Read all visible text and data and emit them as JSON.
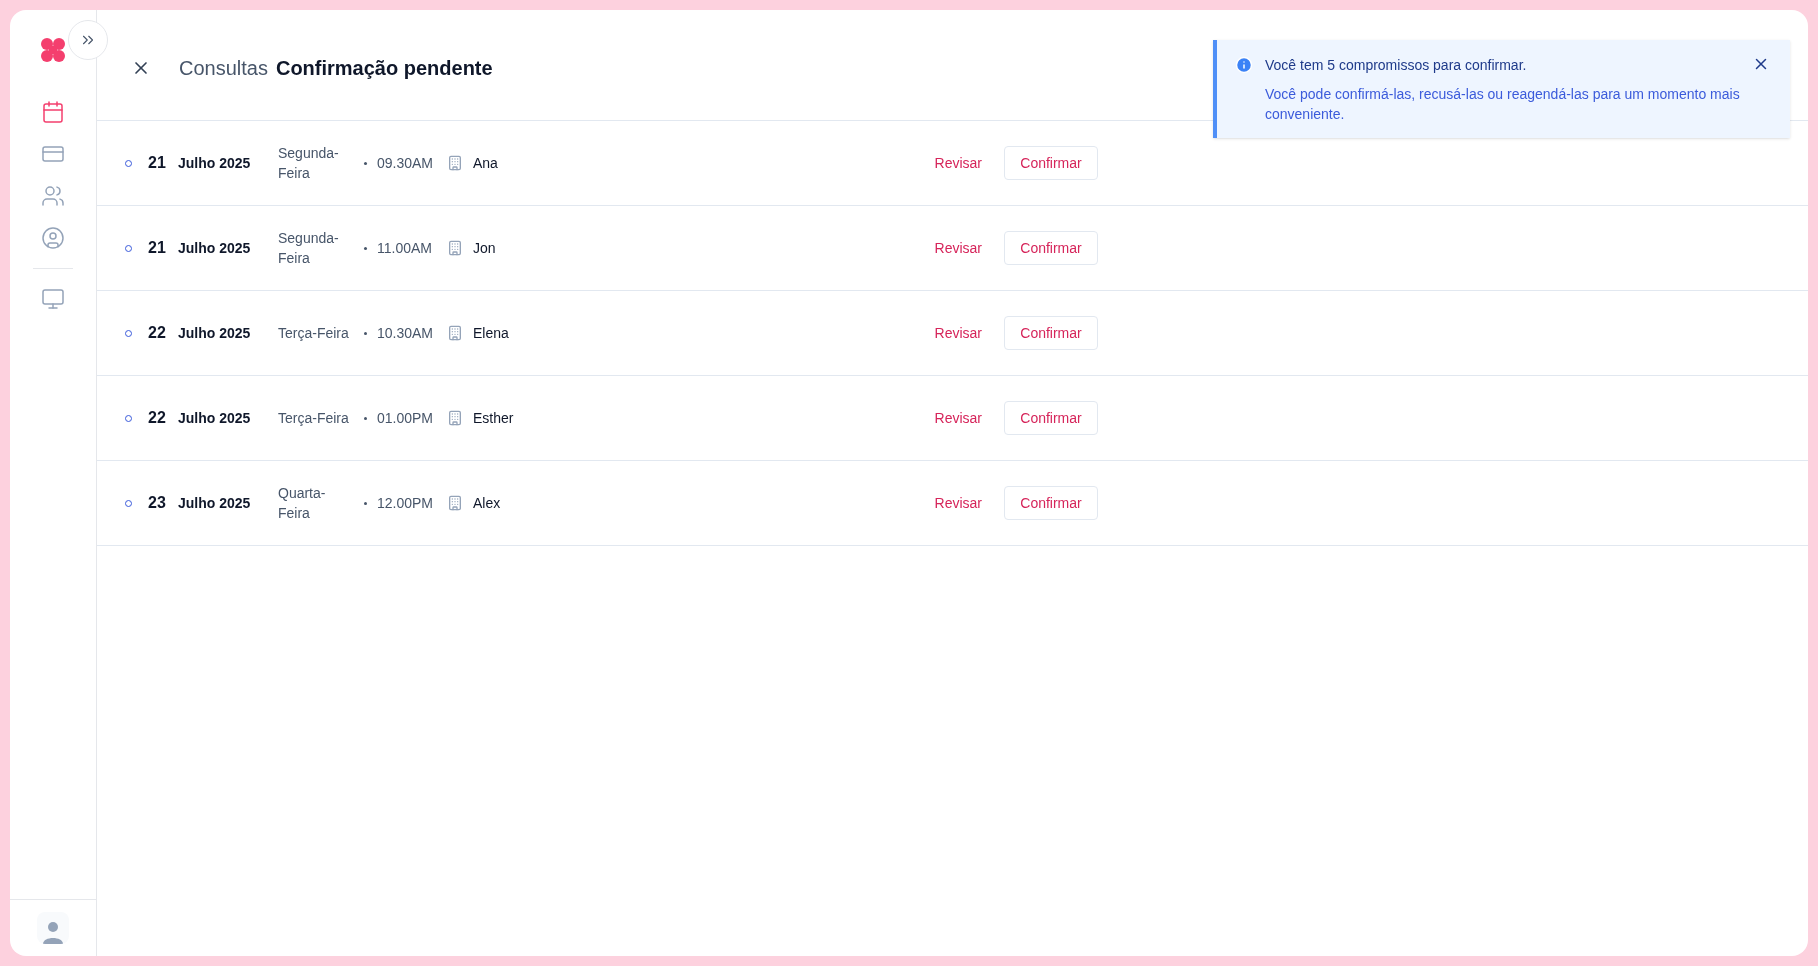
{
  "sidebar": {
    "items": [
      {
        "kind": "calendar",
        "selected": true
      },
      {
        "kind": "card",
        "selected": false
      },
      {
        "kind": "people",
        "selected": false
      },
      {
        "kind": "profile",
        "selected": false
      },
      {
        "kind": "monitor",
        "selected": false
      }
    ]
  },
  "header": {
    "section": "Consultas",
    "title": "Confirmação pendente"
  },
  "appointments": [
    {
      "day": "21",
      "month": "Julho 2025",
      "weekday": "Segunda-Feira",
      "time": "09.30AM",
      "name": "Ana",
      "review": "Revisar",
      "confirm": "Confirmar"
    },
    {
      "day": "21",
      "month": "Julho 2025",
      "weekday": "Segunda-Feira",
      "time": "11.00AM",
      "name": "Jon",
      "review": "Revisar",
      "confirm": "Confirmar"
    },
    {
      "day": "22",
      "month": "Julho 2025",
      "weekday": "Terça-Feira",
      "time": "10.30AM",
      "name": "Elena",
      "review": "Revisar",
      "confirm": "Confirmar"
    },
    {
      "day": "22",
      "month": "Julho 2025",
      "weekday": "Terça-Feira",
      "time": "01.00PM",
      "name": "Esther",
      "review": "Revisar",
      "confirm": "Confirmar"
    },
    {
      "day": "23",
      "month": "Julho 2025",
      "weekday": "Quarta-Feira",
      "time": "12.00PM",
      "name": "Alex",
      "review": "Revisar",
      "confirm": "Confirmar"
    }
  ],
  "notification": {
    "title": "Você tem 5 compromissos para confirmar.",
    "message": "Você pode confirmá-las, recusá-las ou reagendá-las para um momento mais conveniente."
  }
}
